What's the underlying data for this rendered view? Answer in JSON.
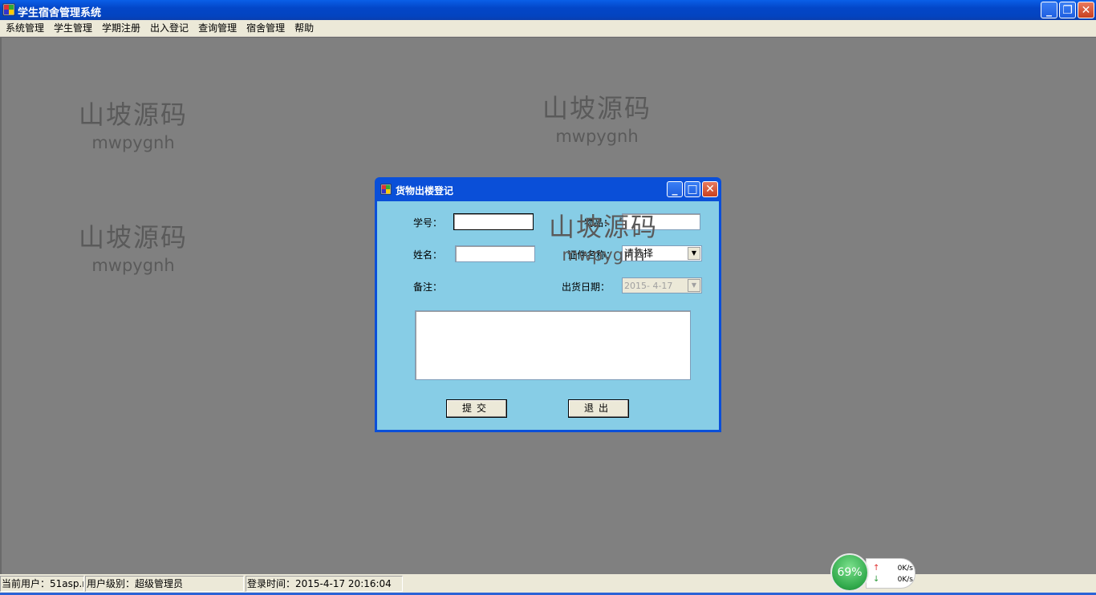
{
  "window": {
    "title": "学生宿舍管理系统"
  },
  "menu": {
    "items": [
      "系统管理",
      "学生管理",
      "学期注册",
      "出入登记",
      "查询管理",
      "宿舍管理",
      "帮助"
    ]
  },
  "watermarks": [
    {
      "text": "山坡源码",
      "sub": "mwpygnh"
    },
    {
      "text": "山坡源码",
      "sub": "mwpygnh"
    },
    {
      "text": "山坡源码",
      "sub": "mwpygnh"
    },
    {
      "text": "山坡源码",
      "sub": "mwpygnh"
    }
  ],
  "dialog": {
    "title": "货物出楼登记",
    "student_id_label": "学号：",
    "student_id_value": "",
    "item_label": "物品：",
    "item_value": "",
    "name_label": "姓名：",
    "name_value": "",
    "cert_label": "证件名称：",
    "cert_value": "请选择",
    "remark_label": "备注：",
    "remark_value": "",
    "date_label": "出货日期：",
    "date_value": "2015- 4-17",
    "submit_label": "提交",
    "exit_label": "退出"
  },
  "status": {
    "current_user": "当前用户：51asp.n",
    "user_level": "用户级别：超级管理员",
    "login_time": "登录时间：2015-4-17 20:16:04"
  },
  "net": {
    "percent": "69%",
    "up": "0K/s",
    "down": "0K/s"
  },
  "colors": {
    "titlebar": "#0346c8",
    "dialog_body": "#87cde6",
    "mdi_bg": "#808080"
  }
}
